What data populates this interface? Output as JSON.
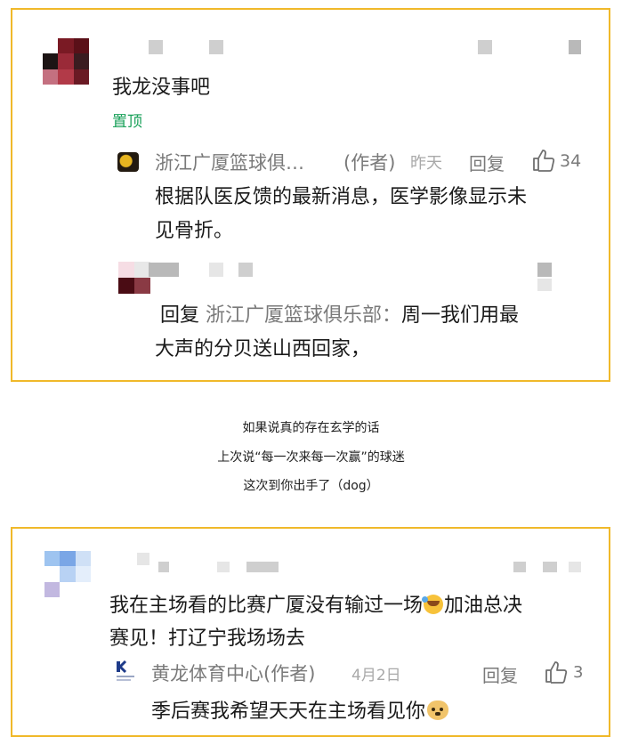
{
  "post1": {
    "top_comment": "我龙没事吧",
    "pinned_label": "置顶",
    "reply1": {
      "author": "浙江广厦篮球俱…",
      "author_tag": "(作者)",
      "time": "昨天",
      "reply_label": "回复",
      "likes": "34",
      "text_line1": "根据队医反馈的最新消息，医学影像显示未",
      "text_line2": "见骨折。"
    },
    "reply2": {
      "reply_prefix": "回复",
      "reply_target": "浙江广厦篮球俱乐部：",
      "text_line1_rest": "周一我们用最",
      "text_line2": "大声的分贝送山西回家，"
    }
  },
  "caption": {
    "line1": "如果说真的存在玄学的话",
    "line2": "上次说“每一次来每一次赢”的球迷",
    "line3": "这次到你出手了（dog）"
  },
  "post2": {
    "top_comment_line1": "我在主场看的比赛广厦没有输过一场",
    "top_comment_line1_tail": "加油总决",
    "top_comment_line2": "赛见！打辽宁我场场去",
    "reply1": {
      "author": "黄龙体育中心(作者)",
      "time": "4月2日",
      "reply_label": "回复",
      "likes": "3",
      "text": "季后赛我希望天天在主场看见你"
    }
  },
  "icons": {
    "thumb": "thumbs-up-icon",
    "laugh_emoji": "laughing-crying-emoji",
    "doge_emoji": "doge-emoji"
  }
}
